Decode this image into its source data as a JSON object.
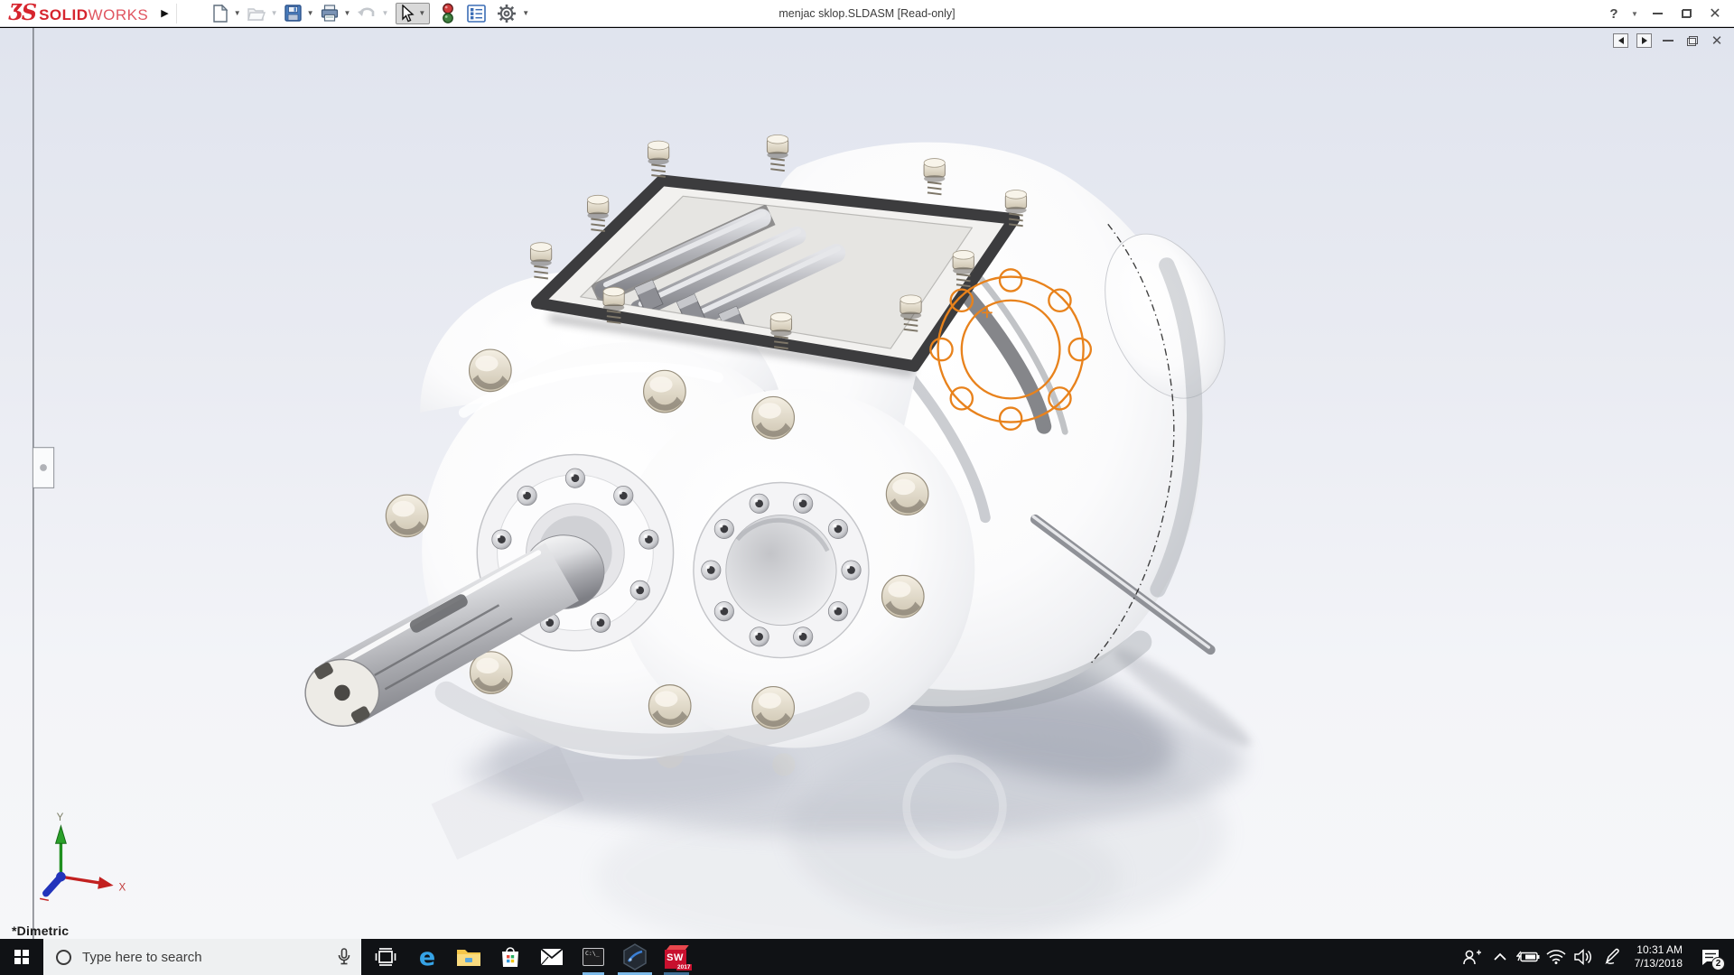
{
  "titlebar": {
    "logo_mark": "ƷS",
    "brand_solid": "SOLID",
    "brand_works": "WORKS",
    "title": "menjac sklop.SLDASM [Read-only]",
    "help_label": "?",
    "tools": [
      {
        "name": "new-document-icon"
      },
      {
        "name": "open-document-icon"
      },
      {
        "name": "save-icon"
      },
      {
        "name": "print-icon"
      },
      {
        "name": "undo-icon"
      },
      {
        "name": "select-cursor-icon",
        "state": "active"
      },
      {
        "name": "rebuild-traffic-light-icon"
      },
      {
        "name": "file-properties-icon"
      },
      {
        "name": "options-gear-icon"
      }
    ]
  },
  "document_window": {
    "controls": [
      "previous-pane",
      "next-pane",
      "minimize",
      "restore",
      "close"
    ]
  },
  "viewport": {
    "view_orientation_label": "*Dimetric",
    "triad": {
      "x_label": "X",
      "y_label": "Y"
    },
    "selection_color": "#E8821C",
    "background_top": "#e0e4ee",
    "background_bottom": "#f6f7f9"
  },
  "taskbar": {
    "search": {
      "placeholder": "Type here to search"
    },
    "apps": [
      {
        "name": "task-view",
        "running": false
      },
      {
        "name": "microsoft-edge",
        "glyph": "e",
        "running": false
      },
      {
        "name": "file-explorer",
        "running": false
      },
      {
        "name": "microsoft-store",
        "running": false
      },
      {
        "name": "mail",
        "running": false
      },
      {
        "name": "command-prompt",
        "label": "C:\\_",
        "running": true
      },
      {
        "name": "hexagon-app",
        "running": true,
        "active": true
      },
      {
        "name": "solidworks-2017",
        "label": "SW",
        "year": "2017",
        "running": true
      }
    ],
    "tray": {
      "time": "10:31 AM",
      "date": "7/13/2018",
      "notification_count": "2"
    }
  }
}
